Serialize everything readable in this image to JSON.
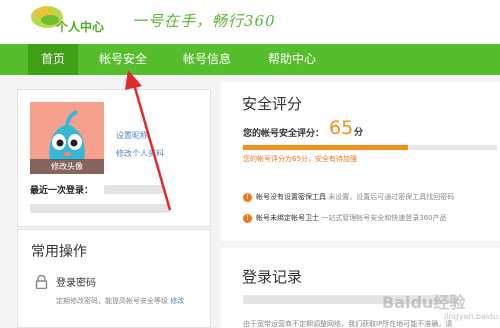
{
  "header": {
    "logo_text": "个人中心",
    "slogan": "一号在手，畅行360"
  },
  "nav": {
    "items": [
      {
        "label": "首页",
        "active": true
      },
      {
        "label": "帐号安全",
        "active": false
      },
      {
        "label": "帐号信息",
        "active": false
      },
      {
        "label": "帮助中心",
        "active": false
      }
    ]
  },
  "profile": {
    "avatar_caption": "修改头像",
    "nickname_link": "设置昵称",
    "edit_profile_link": "修改个人资料",
    "last_login_label": "最近一次登录："
  },
  "common_ops": {
    "title": "常用操作",
    "items": [
      {
        "icon": "lock-icon",
        "title": "登录密码",
        "desc": "定期修改密码，能提高帐号安全等级",
        "action": "修改"
      }
    ]
  },
  "security": {
    "title": "安全评分",
    "score_label": "您的帐号安全评分：",
    "score": "65",
    "score_unit": "分",
    "score_fraction": 0.65,
    "score_note": "您的帐号评分为65分，安全有待加强",
    "tips": [
      {
        "icon": "warning-icon",
        "main": "帐号没有设置密保工具",
        "detail": "未设置，设置后可通过密保工具找回密码"
      },
      {
        "icon": "warning-icon",
        "main": "帐号未绑定帐号卫士",
        "detail": "一站式管理帐号安全和快速登录360产品"
      }
    ]
  },
  "login_records": {
    "title": "登录记录",
    "note": "由于宽带运营商不定期调整网络，我们获取IP所在地可能不准确，请"
  },
  "watermark": {
    "text": "Baidu经验",
    "sub": "jingyan.baidu.com"
  },
  "colors": {
    "brand_green": "#56be2c",
    "nav_active": "#3f9f16",
    "score_orange": "#f39019",
    "link_blue": "#4a88c6",
    "annotation_red": "#e22a2a"
  }
}
